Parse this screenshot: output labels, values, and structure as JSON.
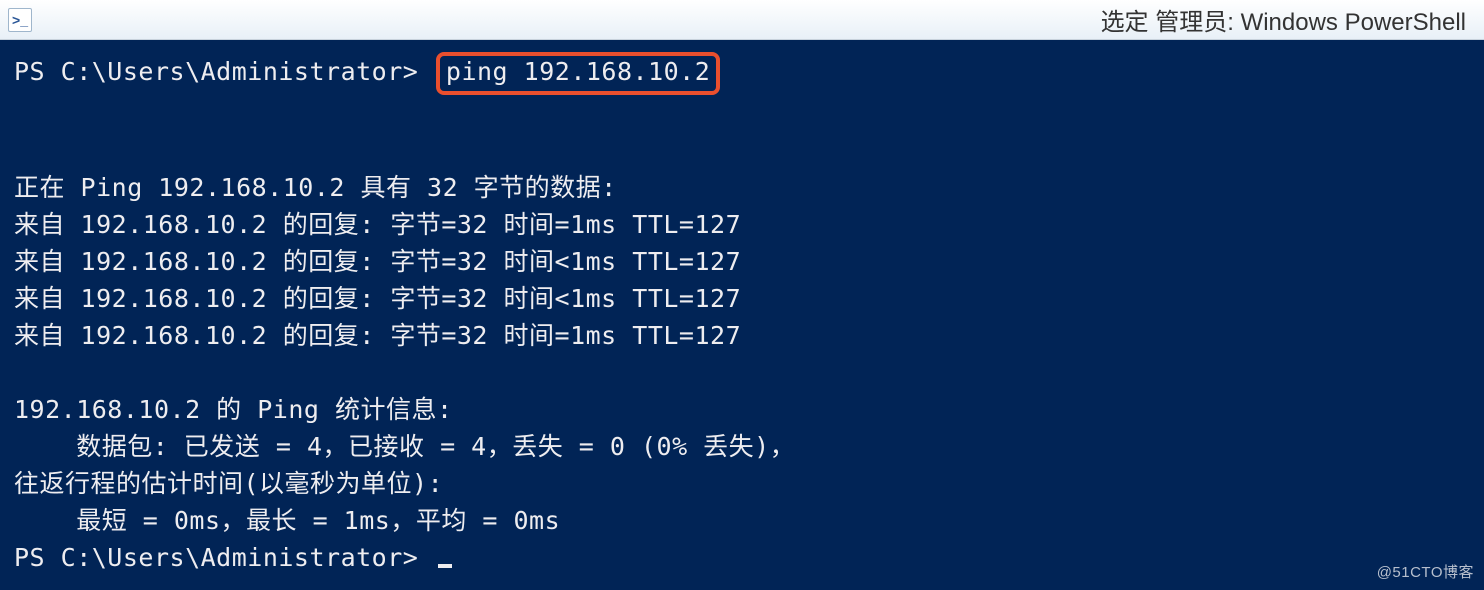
{
  "window": {
    "title": "选定 管理员: Windows PowerShell",
    "icon_label": ">_"
  },
  "terminal": {
    "prompt1_prefix": "PS C:\\Users\\Administrator>",
    "command": "ping 192.168.10.2",
    "blank1": "",
    "line_ping_header": "正在 Ping 192.168.10.2 具有 32 字节的数据:",
    "reply1": "来自 192.168.10.2 的回复: 字节=32 时间=1ms TTL=127",
    "reply2": "来自 192.168.10.2 的回复: 字节=32 时间<1ms TTL=127",
    "reply3": "来自 192.168.10.2 的回复: 字节=32 时间<1ms TTL=127",
    "reply4": "来自 192.168.10.2 的回复: 字节=32 时间=1ms TTL=127",
    "blank2": "",
    "stats_header": "192.168.10.2 的 Ping 统计信息:",
    "stats_packets": "    数据包: 已发送 = 4，已接收 = 4，丢失 = 0 (0% 丢失)，",
    "stats_rtt_header": "往返行程的估计时间(以毫秒为单位):",
    "stats_rtt": "    最短 = 0ms，最长 = 1ms，平均 = 0ms",
    "prompt2": "PS C:\\Users\\Administrator> "
  },
  "watermark": "@51CTO博客"
}
